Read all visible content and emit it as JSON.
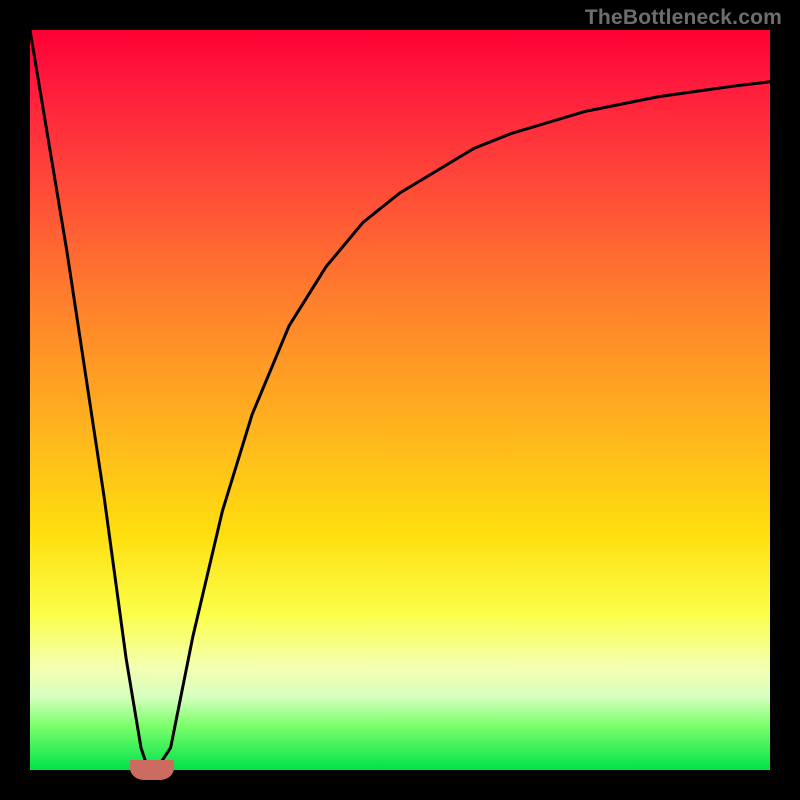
{
  "watermark": "TheBottleneck.com",
  "colors": {
    "frame": "#000000",
    "curve": "#000000",
    "marker": "#cc6b5f",
    "gradient_stops": [
      "#ff0033",
      "#ff7a2e",
      "#ffde0f",
      "#f5ffb0",
      "#00e24a"
    ]
  },
  "chart_data": {
    "type": "line",
    "title": "",
    "xlabel": "",
    "ylabel": "",
    "xlim": [
      0,
      100
    ],
    "ylim": [
      0,
      100
    ],
    "x": [
      0,
      5,
      10,
      13,
      15,
      16,
      17,
      19,
      22,
      26,
      30,
      35,
      40,
      45,
      50,
      55,
      60,
      65,
      70,
      75,
      80,
      85,
      90,
      95,
      100
    ],
    "values": [
      100,
      70,
      37,
      15,
      3,
      0,
      0,
      3,
      18,
      35,
      48,
      60,
      68,
      74,
      78,
      81,
      84,
      86,
      87.5,
      89,
      90,
      91,
      91.7,
      92.4,
      93
    ],
    "notch_x": 16.5,
    "notch_y": 0,
    "description": "V-shaped curve dipping to zero near x≈16 then asymptotically rising toward ~93% at right edge; background gradient encodes value (red high, green low)."
  }
}
